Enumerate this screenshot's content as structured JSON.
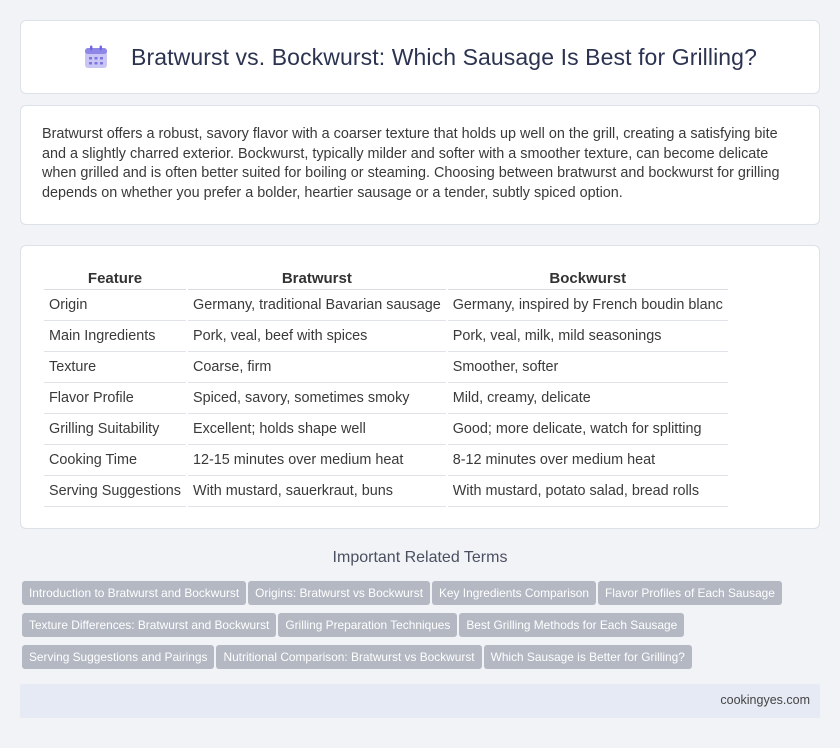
{
  "header": {
    "title": "Bratwurst vs. Bockwurst: Which Sausage Is Best for Grilling?",
    "icon": "calendar-icon"
  },
  "intro": "Bratwurst offers a robust, savory flavor with a coarser texture that holds up well on the grill, creating a satisfying bite and a slightly charred exterior. Bockwurst, typically milder and softer with a smoother texture, can become delicate when grilled and is often better suited for boiling or steaming. Choosing between bratwurst and bockwurst for grilling depends on whether you prefer a bolder, heartier sausage or a tender, subtly spiced option.",
  "table": {
    "headers": [
      "Feature",
      "Bratwurst",
      "Bockwurst"
    ],
    "rows": [
      [
        "Origin",
        "Germany, traditional Bavarian sausage",
        "Germany, inspired by French boudin blanc"
      ],
      [
        "Main Ingredients",
        "Pork, veal, beef with spices",
        "Pork, veal, milk, mild seasonings"
      ],
      [
        "Texture",
        "Coarse, firm",
        "Smoother, softer"
      ],
      [
        "Flavor Profile",
        "Spiced, savory, sometimes smoky",
        "Mild, creamy, delicate"
      ],
      [
        "Grilling Suitability",
        "Excellent; holds shape well",
        "Good; more delicate, watch for splitting"
      ],
      [
        "Cooking Time",
        "12-15 minutes over medium heat",
        "8-12 minutes over medium heat"
      ],
      [
        "Serving Suggestions",
        "With mustard, sauerkraut, buns",
        "With mustard, potato salad, bread rolls"
      ]
    ]
  },
  "related": {
    "title": "Important Related Terms",
    "tags": [
      "Introduction to Bratwurst and Bockwurst",
      "Origins: Bratwurst vs Bockwurst",
      "Key Ingredients Comparison",
      "Flavor Profiles of Each Sausage",
      "Texture Differences: Bratwurst and Bockwurst",
      "Grilling Preparation Techniques",
      "Best Grilling Methods for Each Sausage",
      "Serving Suggestions and Pairings",
      "Nutritional Comparison: Bratwurst vs Bockwurst",
      "Which Sausage is Better for Grilling?"
    ]
  },
  "footer": {
    "site": "cookingyes.com"
  }
}
